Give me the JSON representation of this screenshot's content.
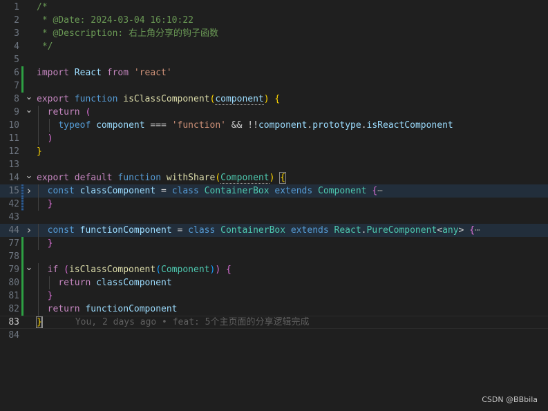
{
  "editor": {
    "lines": [
      {
        "num": "1",
        "fold": "",
        "diff": "",
        "tokens": [
          [
            "comment",
            "/*"
          ]
        ]
      },
      {
        "num": "2",
        "fold": "",
        "diff": "",
        "tokens": [
          [
            "comment",
            " * @Date: 2024-03-04 16:10:22"
          ]
        ]
      },
      {
        "num": "3",
        "fold": "",
        "diff": "",
        "tokens": [
          [
            "comment",
            " * @Description: 右上角分享的钩子函数"
          ]
        ]
      },
      {
        "num": "4",
        "fold": "",
        "diff": "",
        "tokens": [
          [
            "comment",
            " */"
          ]
        ]
      },
      {
        "num": "5",
        "fold": "",
        "diff": "",
        "tokens": []
      },
      {
        "num": "6",
        "fold": "",
        "diff": "added",
        "tokens": [
          [
            "control",
            "import"
          ],
          [
            "op",
            " "
          ],
          [
            "var",
            "React"
          ],
          [
            "op",
            " "
          ],
          [
            "control",
            "from"
          ],
          [
            "op",
            " "
          ],
          [
            "string",
            "'react'"
          ]
        ]
      },
      {
        "num": "7",
        "fold": "",
        "diff": "added",
        "tokens": []
      },
      {
        "num": "8",
        "fold": "open",
        "diff": "",
        "tokens": [
          [
            "control",
            "export"
          ],
          [
            "op",
            " "
          ],
          [
            "keyword",
            "function"
          ],
          [
            "op",
            " "
          ],
          [
            "func",
            "isClassComponent"
          ],
          [
            "brace1",
            "("
          ],
          [
            "var",
            "component"
          ],
          [
            "brace1",
            ")"
          ],
          [
            "op",
            " "
          ],
          [
            "brace1",
            "{"
          ]
        ]
      },
      {
        "num": "9",
        "fold": "open",
        "diff": "",
        "tokens": [
          [
            "op",
            "  "
          ],
          [
            "control",
            "return"
          ],
          [
            "op",
            " "
          ],
          [
            "brace2",
            "("
          ]
        ]
      },
      {
        "num": "10",
        "fold": "",
        "diff": "",
        "tokens": [
          [
            "op",
            "    "
          ],
          [
            "keyword",
            "typeof"
          ],
          [
            "op",
            " "
          ],
          [
            "var",
            "component"
          ],
          [
            "op",
            " === "
          ],
          [
            "string",
            "'function'"
          ],
          [
            "op",
            " && !!"
          ],
          [
            "var",
            "component"
          ],
          [
            "op",
            "."
          ],
          [
            "var",
            "prototype"
          ],
          [
            "op",
            "."
          ],
          [
            "var",
            "isReactComponent"
          ]
        ]
      },
      {
        "num": "11",
        "fold": "",
        "diff": "",
        "tokens": [
          [
            "op",
            "  "
          ],
          [
            "brace2",
            ")"
          ]
        ]
      },
      {
        "num": "12",
        "fold": "",
        "diff": "",
        "tokens": [
          [
            "brace1",
            "}"
          ]
        ]
      },
      {
        "num": "13",
        "fold": "",
        "diff": "",
        "tokens": []
      },
      {
        "num": "14",
        "fold": "open",
        "diff": "",
        "tokens": [
          [
            "control",
            "export"
          ],
          [
            "op",
            " "
          ],
          [
            "control",
            "default"
          ],
          [
            "op",
            " "
          ],
          [
            "keyword",
            "function"
          ],
          [
            "op",
            " "
          ],
          [
            "func",
            "withShare"
          ],
          [
            "brace1",
            "("
          ],
          [
            "class",
            "Component"
          ],
          [
            "brace1",
            ")"
          ],
          [
            "op",
            " "
          ],
          [
            "brace1",
            "{"
          ]
        ]
      },
      {
        "num": "15",
        "fold": "closed",
        "diff": "modified",
        "hl": true,
        "tokens": [
          [
            "op",
            "  "
          ],
          [
            "keyword",
            "const"
          ],
          [
            "op",
            " "
          ],
          [
            "var",
            "classComponent"
          ],
          [
            "op",
            " = "
          ],
          [
            "keyword",
            "class"
          ],
          [
            "op",
            " "
          ],
          [
            "class",
            "ContainerBox"
          ],
          [
            "op",
            " "
          ],
          [
            "keyword",
            "extends"
          ],
          [
            "op",
            " "
          ],
          [
            "class",
            "Component"
          ],
          [
            "op",
            " "
          ],
          [
            "brace2",
            "{"
          ],
          [
            "fold-ell",
            "⋯"
          ]
        ]
      },
      {
        "num": "42",
        "fold": "",
        "diff": "modified",
        "tokens": [
          [
            "op",
            "  "
          ],
          [
            "brace2",
            "}"
          ]
        ]
      },
      {
        "num": "43",
        "fold": "",
        "diff": "",
        "tokens": []
      },
      {
        "num": "44",
        "fold": "closed",
        "diff": "",
        "hl": true,
        "tokens": [
          [
            "op",
            "  "
          ],
          [
            "keyword",
            "const"
          ],
          [
            "op",
            " "
          ],
          [
            "var",
            "functionComponent"
          ],
          [
            "op",
            " = "
          ],
          [
            "keyword",
            "class"
          ],
          [
            "op",
            " "
          ],
          [
            "class",
            "ContainerBox"
          ],
          [
            "op",
            " "
          ],
          [
            "keyword",
            "extends"
          ],
          [
            "op",
            " "
          ],
          [
            "class",
            "React"
          ],
          [
            "op",
            "."
          ],
          [
            "class",
            "PureComponent"
          ],
          [
            "op",
            "<"
          ],
          [
            "class",
            "any"
          ],
          [
            "op",
            "> "
          ],
          [
            "brace2",
            "{"
          ],
          [
            "fold-ell",
            "⋯"
          ]
        ]
      },
      {
        "num": "77",
        "fold": "",
        "diff": "added",
        "tokens": [
          [
            "op",
            "  "
          ],
          [
            "brace2",
            "}"
          ]
        ]
      },
      {
        "num": "78",
        "fold": "",
        "diff": "added",
        "tokens": []
      },
      {
        "num": "79",
        "fold": "open",
        "diff": "added",
        "tokens": [
          [
            "op",
            "  "
          ],
          [
            "control",
            "if"
          ],
          [
            "op",
            " "
          ],
          [
            "brace2",
            "("
          ],
          [
            "func",
            "isClassComponent"
          ],
          [
            "brace3",
            "("
          ],
          [
            "class",
            "Component"
          ],
          [
            "brace3",
            ")"
          ],
          [
            "brace2",
            ")"
          ],
          [
            "op",
            " "
          ],
          [
            "brace2",
            "{"
          ]
        ]
      },
      {
        "num": "80",
        "fold": "",
        "diff": "added",
        "tokens": [
          [
            "op",
            "    "
          ],
          [
            "control",
            "return"
          ],
          [
            "op",
            " "
          ],
          [
            "var",
            "classComponent"
          ]
        ]
      },
      {
        "num": "81",
        "fold": "",
        "diff": "added",
        "tokens": [
          [
            "op",
            "  "
          ],
          [
            "brace2",
            "}"
          ]
        ]
      },
      {
        "num": "82",
        "fold": "",
        "diff": "added",
        "tokens": [
          [
            "op",
            "  "
          ],
          [
            "control",
            "return"
          ],
          [
            "op",
            " "
          ],
          [
            "var",
            "functionComponent"
          ]
        ]
      },
      {
        "num": "83",
        "fold": "",
        "diff": "",
        "current": true,
        "tokens": [
          [
            "brace1",
            "}"
          ]
        ]
      },
      {
        "num": "84",
        "fold": "",
        "diff": "",
        "tokens": []
      }
    ],
    "blame": "You, 2 days ago • feat: 5个主页面的分享逻辑完成"
  },
  "watermark": "CSDN @BBbila"
}
